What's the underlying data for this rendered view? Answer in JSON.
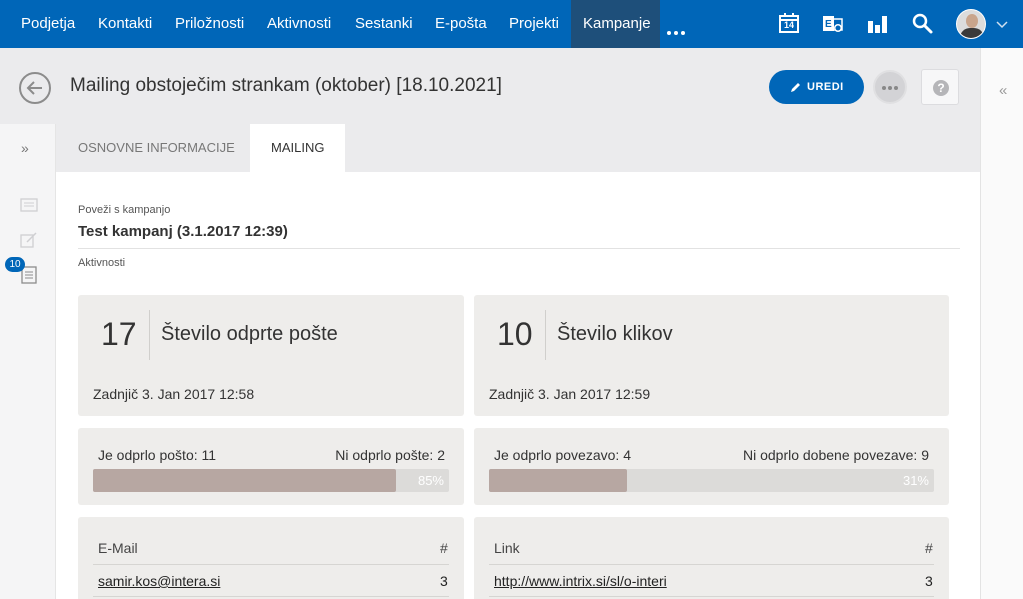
{
  "nav": {
    "items": [
      "Podjetja",
      "Kontakti",
      "Priložnosti",
      "Aktivnosti",
      "Sestanki",
      "E-pošta",
      "Projekti",
      "Kampanje"
    ],
    "active": "Kampanje",
    "calendar_day": "14",
    "icons": [
      "calendar-icon",
      "exchange-icon",
      "chart-icon",
      "search-icon"
    ]
  },
  "header": {
    "title": "Mailing obstoječim strankam (oktober) [18.10.2021]",
    "edit_label": "UREDI",
    "help_label": "?"
  },
  "sidebar": {
    "badge": "10"
  },
  "tabs": {
    "basic": "OSNOVNE INFORMACIJE",
    "mailing": "MAILING"
  },
  "content": {
    "link_label": "Poveži s kampanjo",
    "link_value": "Test kampanj (3.1.2017 12:39)",
    "activities_label": "Aktivnosti"
  },
  "stats": {
    "opens": {
      "count": "17",
      "title": "Število odprte pošte",
      "last": "Zadnjič 3. Jan 2017 12:58"
    },
    "clicks": {
      "count": "10",
      "title": "Število klikov",
      "last": "Zadnjič 3. Jan 2017 12:59"
    }
  },
  "bars": {
    "opens": {
      "left": "Je odprlo pošto: 11",
      "right": "Ni odprlo pošte: 2",
      "pct_label": "85%",
      "pct": 0.85
    },
    "clicks": {
      "left": "Je odprlo povezavo: 4",
      "right": "Ni odprlo dobene povezave: 9",
      "pct_label": "31%",
      "pct": 0.31
    }
  },
  "tables": {
    "email": {
      "col1": "E-Mail",
      "col2": "#",
      "rows": [
        {
          "value": "samir.kos@intera.si",
          "count": "3"
        }
      ]
    },
    "link": {
      "col1": "Link",
      "col2": "#",
      "rows": [
        {
          "value": "http://www.intrix.si/sl/o-interi",
          "count": "3"
        }
      ]
    }
  },
  "colors": {
    "primary": "#0066b8",
    "nav_active": "#1e4f7a",
    "bar_fill": "#b7a7a2",
    "card_bg": "#eeedeb"
  }
}
